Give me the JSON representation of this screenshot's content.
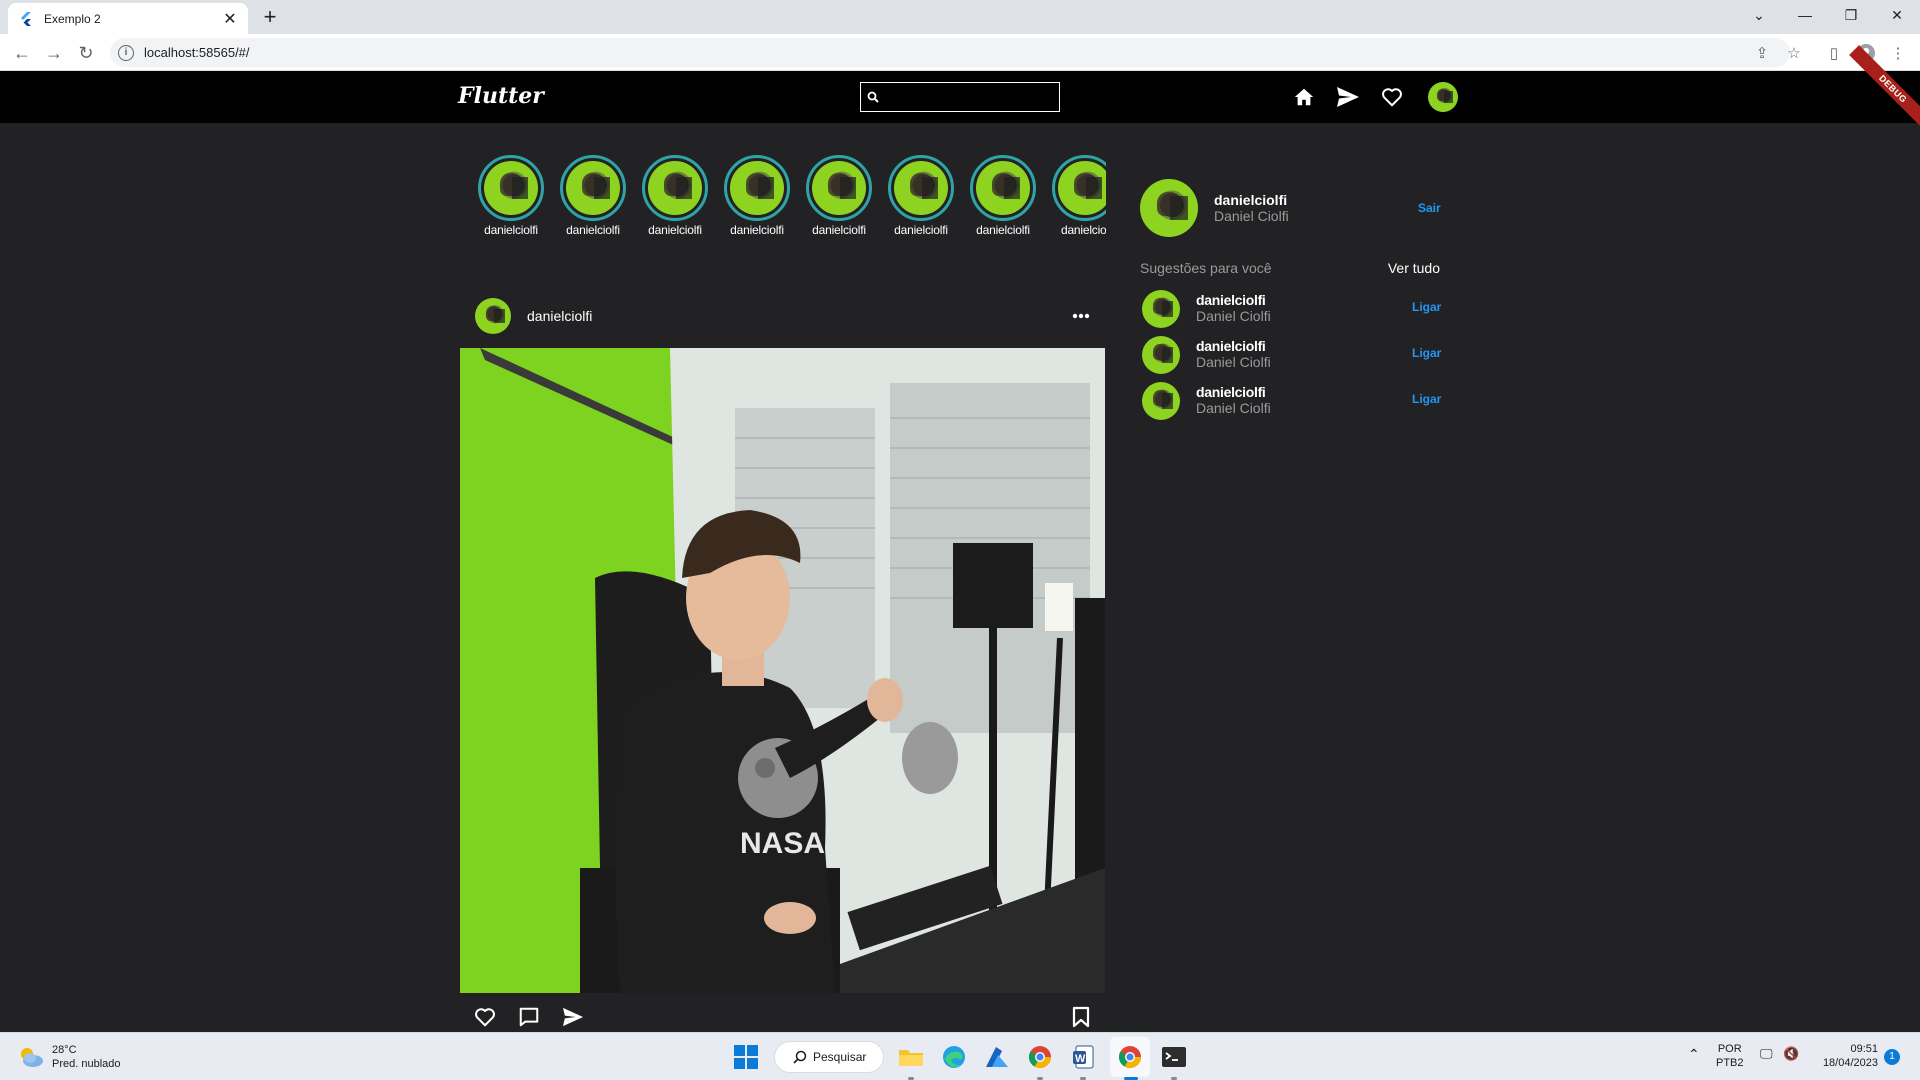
{
  "browser": {
    "tab_title": "Exemplo 2",
    "url": "localhost:58565/#/"
  },
  "app": {
    "brand": "Flutter",
    "search_placeholder": "",
    "debug_label": "DEBUG"
  },
  "stories": [
    {
      "label": "danielciolfi"
    },
    {
      "label": "danielciolfi"
    },
    {
      "label": "danielciolfi"
    },
    {
      "label": "danielciolfi"
    },
    {
      "label": "danielciolfi"
    },
    {
      "label": "danielciolfi"
    },
    {
      "label": "danielciolfi"
    },
    {
      "label": "danielciol"
    }
  ],
  "post": {
    "username": "danielciolfi"
  },
  "profile": {
    "username": "danielciolfi",
    "name": "Daniel Ciolfi",
    "logout_label": "Sair"
  },
  "suggestions": {
    "title": "Sugestões para você",
    "see_all": "Ver tudo",
    "items": [
      {
        "username": "danielciolfi",
        "name": "Daniel Ciolfi",
        "action": "Ligar"
      },
      {
        "username": "danielciolfi",
        "name": "Daniel Ciolfi",
        "action": "Ligar"
      },
      {
        "username": "danielciolfi",
        "name": "Daniel Ciolfi",
        "action": "Ligar"
      }
    ]
  },
  "taskbar": {
    "weather_temp": "28°C",
    "weather_desc": "Pred. nublado",
    "search_label": "Pesquisar",
    "lang_top": "POR",
    "lang_bottom": "PTB2",
    "time": "09:51",
    "date": "18/04/2023",
    "notification_count": "1"
  },
  "colors": {
    "accent": "#2196f3",
    "story_ring": "#2fa4a6",
    "background": "#222224"
  }
}
